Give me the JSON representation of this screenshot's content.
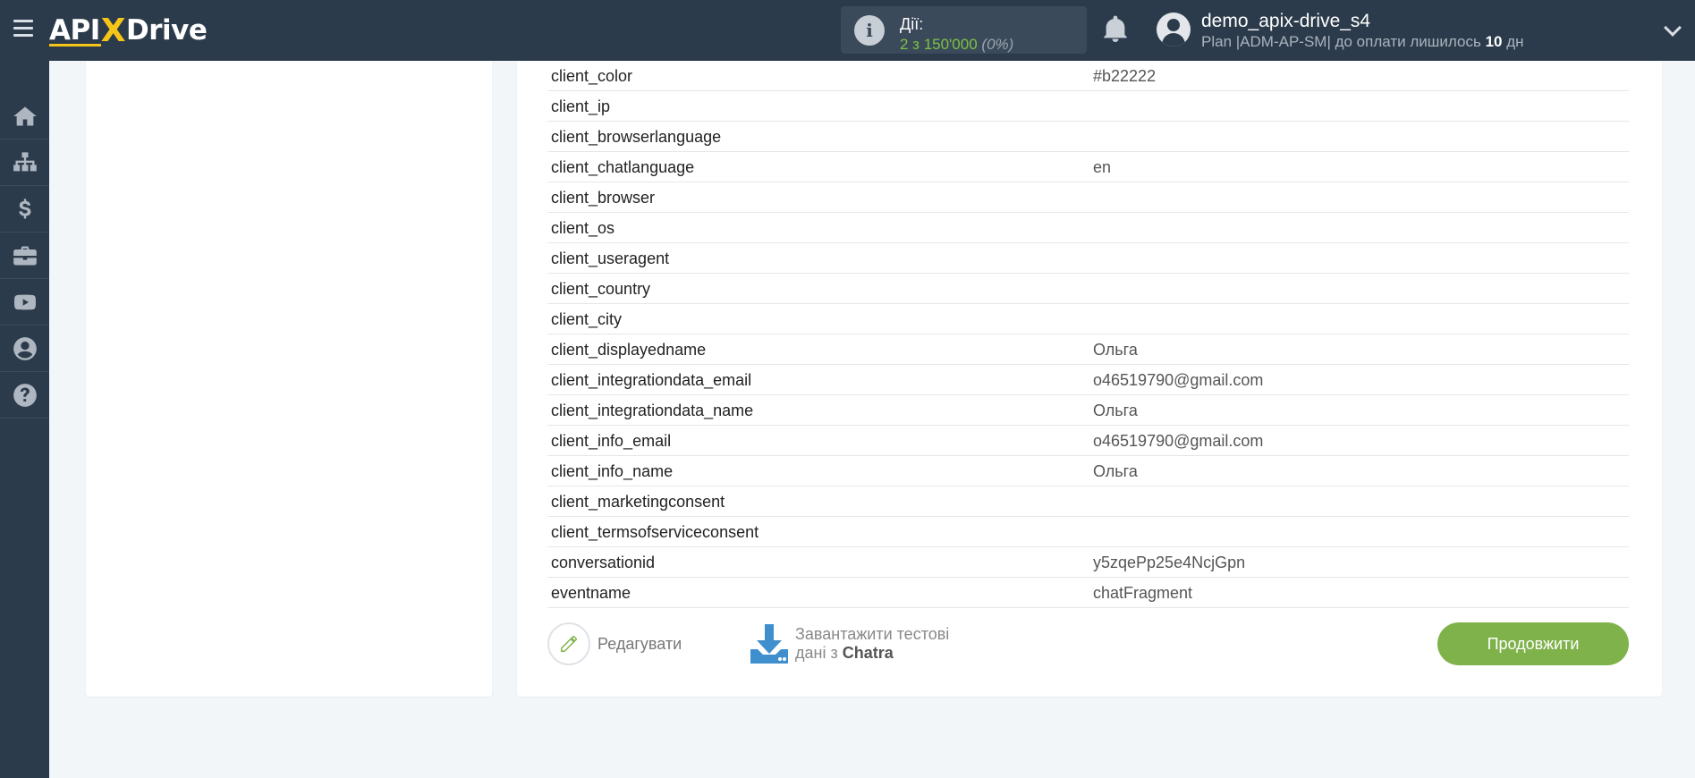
{
  "header": {
    "logo_text": "APIXDrive",
    "actions_label": "Дії:",
    "actions_count": "2 з 150'000",
    "actions_percent": "(0%)",
    "username": "demo_apix-drive_s4",
    "plan_text": "Plan |ADM-AP-SM| до оплати лишилось",
    "days_value": "10",
    "days_unit": "дн"
  },
  "sidebar": {
    "icons": [
      "home-icon",
      "sitemap-icon",
      "dollar-icon",
      "briefcase-icon",
      "youtube-icon",
      "user-icon",
      "help-icon"
    ]
  },
  "fields": [
    {
      "key": "client_color",
      "value": "#b22222"
    },
    {
      "key": "client_ip",
      "value": ""
    },
    {
      "key": "client_browserlanguage",
      "value": ""
    },
    {
      "key": "client_chatlanguage",
      "value": "en"
    },
    {
      "key": "client_browser",
      "value": ""
    },
    {
      "key": "client_os",
      "value": ""
    },
    {
      "key": "client_useragent",
      "value": ""
    },
    {
      "key": "client_country",
      "value": ""
    },
    {
      "key": "client_city",
      "value": ""
    },
    {
      "key": "client_displayedname",
      "value": "Ольга"
    },
    {
      "key": "client_integrationdata_email",
      "value": "o46519790@gmail.com"
    },
    {
      "key": "client_integrationdata_name",
      "value": "Ольга"
    },
    {
      "key": "client_info_email",
      "value": "o46519790@gmail.com"
    },
    {
      "key": "client_info_name",
      "value": "Ольга"
    },
    {
      "key": "client_marketingconsent",
      "value": ""
    },
    {
      "key": "client_termsofserviceconsent",
      "value": ""
    },
    {
      "key": "conversationid",
      "value": "y5zqePp25e4NcjGpn"
    },
    {
      "key": "eventname",
      "value": "chatFragment"
    }
  ],
  "buttons": {
    "edit_label": "Редагувати",
    "download_line1": "Завантажити тестові",
    "download_line2_prefix": "дані з",
    "download_source": "Chatra",
    "continue_label": "Продовжити"
  },
  "colors": {
    "topbar": "#2c3b4b",
    "accent_green": "#7fb24b",
    "logo_yellow": "#f5c518"
  }
}
